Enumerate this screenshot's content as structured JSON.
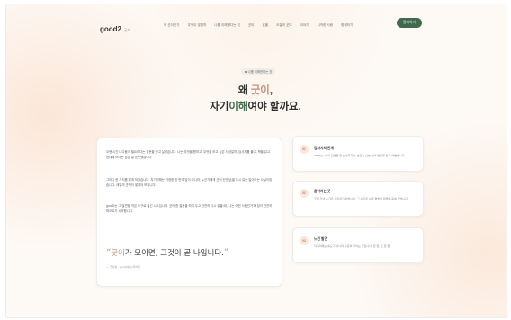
{
  "header": {
    "brand": "good2",
    "brand_mark": "굿이",
    "nav": [
      "왜 굿이인가",
      "무엇이 맞을까",
      "나를 이해한다는 것",
      "굿이",
      "효율",
      "오늘의 굿이",
      "이야기",
      "시작한 사람",
      "함께하기"
    ],
    "cta_label": "함께하기"
  },
  "hero": {
    "pill_label": "나를 이해한다는 것",
    "title_pre": "왜 ",
    "title_accent": "굿이",
    "title_post": ",",
    "subtitle_pre": "자기",
    "subtitle_accent": "이해",
    "subtitle_post": "여야 할까요."
  },
  "main": {
    "paragraphs": [
      "오랜 시간 나다움이 필요하다는 질문을 안고 살았습니다. 나는 무엇을 원하고, 무엇을 하고 싶은 사람일까. 검사지를 풀고, 책을 읽고, 방대해 보이는 답은 늘 흐릿했습니다.",
      "그러다 한 가지를 알게 되었습니다. 자기이해는 거창한 한 번의 답이 아니라, 누군가에게 굿이 건넨 손을 다시 읽는 일이라는 사실이었습니다. 매일의 굿적이 쌓여야 보입니다.",
      "good2는 그 발견을 작은 도구로 옮긴 시도입니다. 굿이 한 질문을 되어 두고 천천히 다시 읽을 때, '나는 어떤 사람인가'에 답이 천천히 떠오르기 시작합니다."
    ],
    "quote_pre": "굿이",
    "quote_post": "가 모이면, 그것이 곧 나입니다.",
    "attribution": "— 굿이를 · good2를 시작하며"
  },
  "cards": [
    {
      "num": "01",
      "title": "검사지의 한계",
      "desc": "MBTI는 '나'의 단면을 잘 보여주지만, 흐르는 오늘 삶의 변화를 담기 어렵습니다."
    },
    {
      "num": "02",
      "title": "흩어지는 굿",
      "desc": "굿이 건넨 순간은 사라지기 쉽습니다. 그 순간은 아주 평범한 하루에 묻혀 있습니다."
    },
    {
      "num": "03",
      "title": "느린 발견",
      "desc": "자기이해는 속도가 아니라 꾸준히 쌓이는 것입니다. 한 줄, 또 한 줄."
    }
  ]
}
